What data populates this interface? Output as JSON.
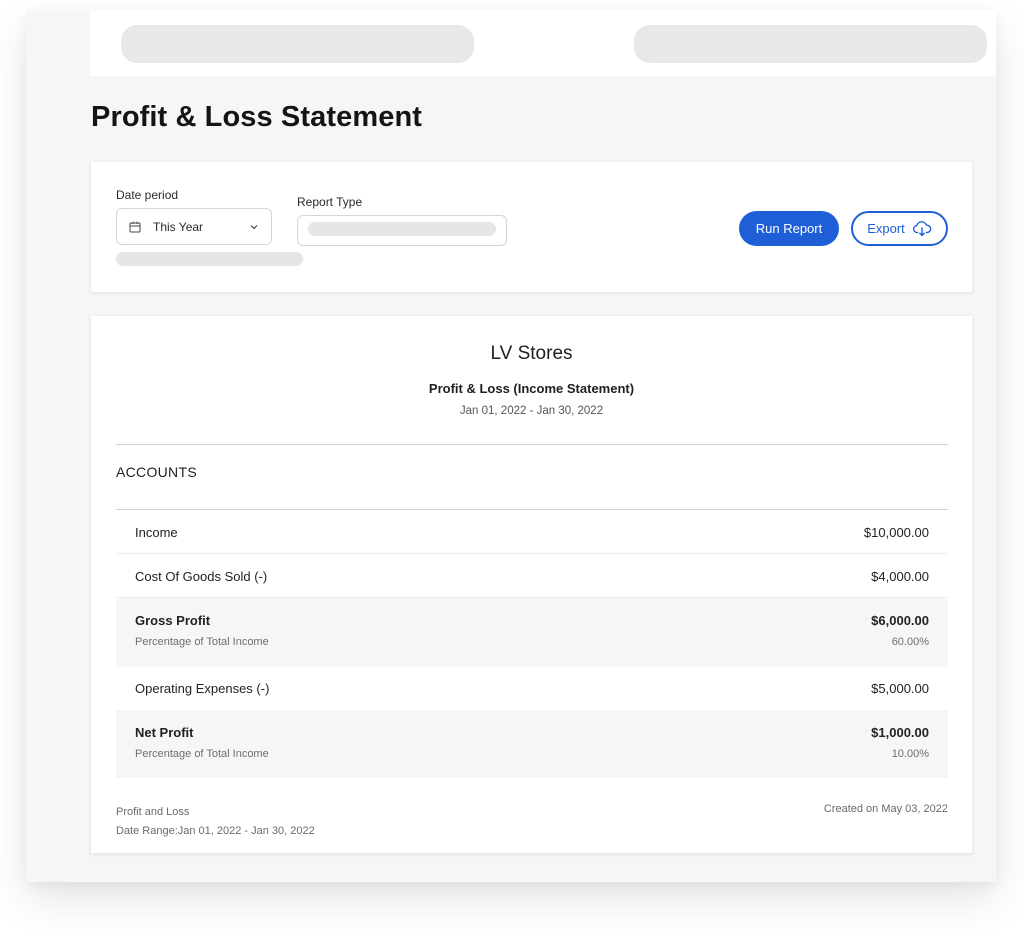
{
  "page": {
    "title": "Profit & Loss Statement"
  },
  "filters": {
    "date_period_label": "Date period",
    "date_period_value": "This Year",
    "report_type_label": "Report Type",
    "run_report_label": "Run Report",
    "export_label": "Export"
  },
  "icons": {
    "calendar": "calendar-icon",
    "chevron": "chevron-down-icon",
    "export": "cloud-download-icon"
  },
  "colors": {
    "accent": "#1e5fd8",
    "shaded_row": "#f6f6f6"
  },
  "report": {
    "company": "LV Stores",
    "title": "Profit & Loss (Income Statement)",
    "range": "Jan 01, 2022 - Jan 30, 2022",
    "accounts_heading": "ACCOUNTS",
    "rows": [
      {
        "label": "Income",
        "value": "$10,000.00"
      },
      {
        "label": "Cost Of Goods Sold (-)",
        "value": "$4,000.00"
      },
      {
        "label": "Gross Profit",
        "value": "$6,000.00",
        "sub_label": "Percentage of Total Income",
        "sub_value": "60.00%"
      },
      {
        "label": "Operating Expenses (-)",
        "value": "$5,000.00"
      },
      {
        "label": "Net Profit",
        "value": "$1,000.00",
        "sub_label": "Percentage of Total Income",
        "sub_value": "10.00%"
      }
    ],
    "footer": {
      "name": "Profit and Loss",
      "date_range": "Date Range:Jan 01, 2022 - Jan 30, 2022",
      "created": "Created on May 03, 2022"
    }
  }
}
